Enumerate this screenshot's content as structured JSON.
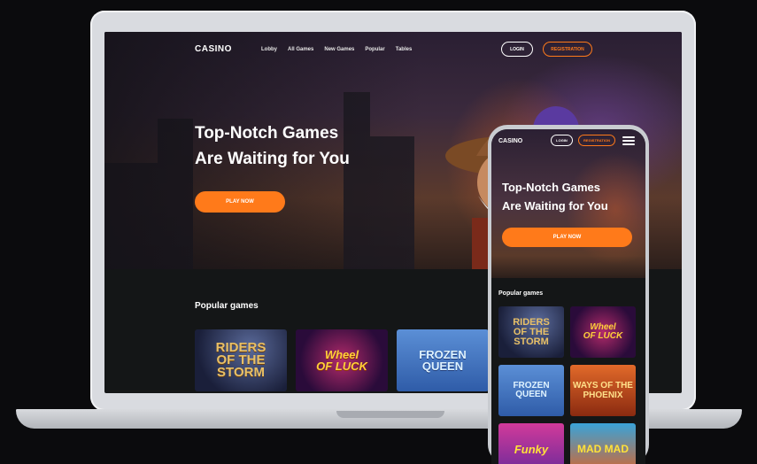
{
  "desktop": {
    "logo": "CASINO",
    "nav": [
      "Lobby",
      "All Games",
      "New Games",
      "Popular",
      "Tables"
    ],
    "login_label": "LOGIN",
    "registration_label": "REGISTRATION",
    "hero_title_line1": "Top-Notch Games",
    "hero_title_line2": "Are Waiting for You",
    "play_label": "PLAY NOW",
    "popular_title": "Popular games",
    "games": [
      {
        "line1": "RIDERS",
        "line2": "OF THE STORM"
      },
      {
        "line1": "Wheel",
        "line2": "OF LUCK"
      },
      {
        "line1": "FROZEN",
        "line2": "QUEEN"
      }
    ]
  },
  "mobile": {
    "logo": "CASINO",
    "login_label": "LOGIN",
    "registration_label": "REGISTRATION",
    "hero_title_line1": "Top-Notch Games",
    "hero_title_line2": "Are Waiting for You",
    "play_label": "PLAY NOW",
    "popular_title": "Popular games",
    "games": [
      {
        "line1": "RIDERS",
        "line2": "OF THE STORM"
      },
      {
        "line1": "Wheel",
        "line2": "OF LUCK"
      },
      {
        "line1": "FROZEN",
        "line2": "QUEEN"
      },
      {
        "line1": "WAYS OF THE",
        "line2": "PHOENIX"
      },
      {
        "line1": "Funky",
        "line2": ""
      },
      {
        "line1": "MAD MAD",
        "line2": ""
      }
    ]
  },
  "colors": {
    "accent": "#ff7a1a",
    "background": "#141617"
  },
  "icons": [
    "hamburger-menu-icon"
  ]
}
